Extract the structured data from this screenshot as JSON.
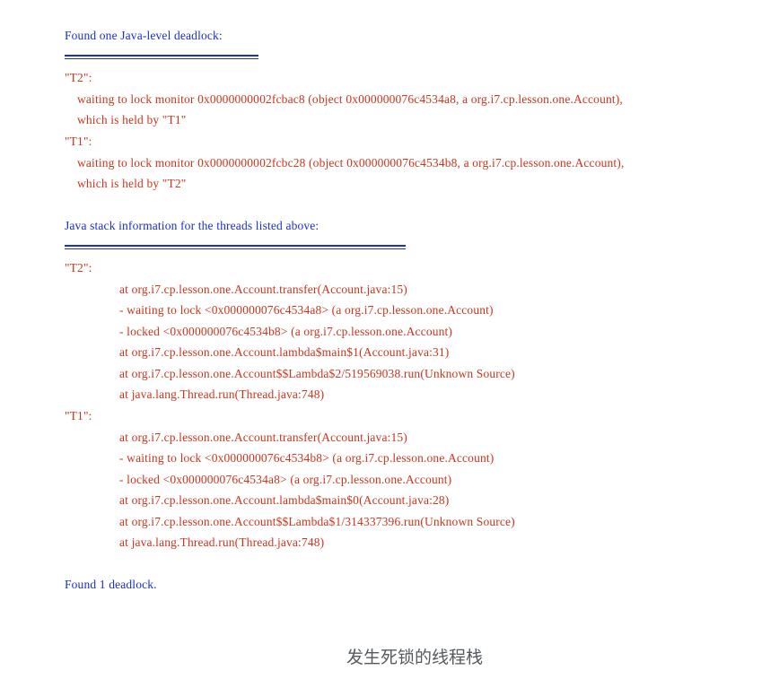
{
  "dump": {
    "header": "Found one Java-level deadlock:",
    "deadlock_summary": [
      {
        "thread": "\"T2\":",
        "waiting": "waiting to lock monitor 0x0000000002fcbac8 (object 0x000000076c4534a8, a org.i7.cp.lesson.one.Account),",
        "held": "which is held by \"T1\""
      },
      {
        "thread": "\"T1\":",
        "waiting": "waiting to lock monitor 0x0000000002fcbc28 (object 0x000000076c4534b8, a org.i7.cp.lesson.one.Account),",
        "held": "which is held by \"T2\""
      }
    ],
    "stack_header": "Java stack information for the threads listed above:",
    "stacks": [
      {
        "thread": "\"T2\":",
        "frames": [
          "at org.i7.cp.lesson.one.Account.transfer(Account.java:15)",
          "- waiting to lock <0x000000076c4534a8> (a org.i7.cp.lesson.one.Account)",
          "- locked <0x000000076c4534b8> (a org.i7.cp.lesson.one.Account)",
          "at org.i7.cp.lesson.one.Account.lambda$main$1(Account.java:31)",
          "at org.i7.cp.lesson.one.Account$$Lambda$2/519569038.run(Unknown Source)",
          "at java.lang.Thread.run(Thread.java:748)"
        ]
      },
      {
        "thread": "\"T1\":",
        "frames": [
          "at org.i7.cp.lesson.one.Account.transfer(Account.java:15)",
          "- waiting to lock <0x000000076c4534b8> (a org.i7.cp.lesson.one.Account)",
          "- locked <0x000000076c4534a8> (a org.i7.cp.lesson.one.Account)",
          "at org.i7.cp.lesson.one.Account.lambda$main$0(Account.java:28)",
          "at org.i7.cp.lesson.one.Account$$Lambda$1/314337396.run(Unknown Source)",
          "at java.lang.Thread.run(Thread.java:748)"
        ]
      }
    ],
    "footer": "Found 1 deadlock."
  },
  "caption": "发生死锁的线程栈",
  "colors": {
    "heading": "#1a2fd0",
    "trace": "#c8361e",
    "caption": "#555a60"
  }
}
